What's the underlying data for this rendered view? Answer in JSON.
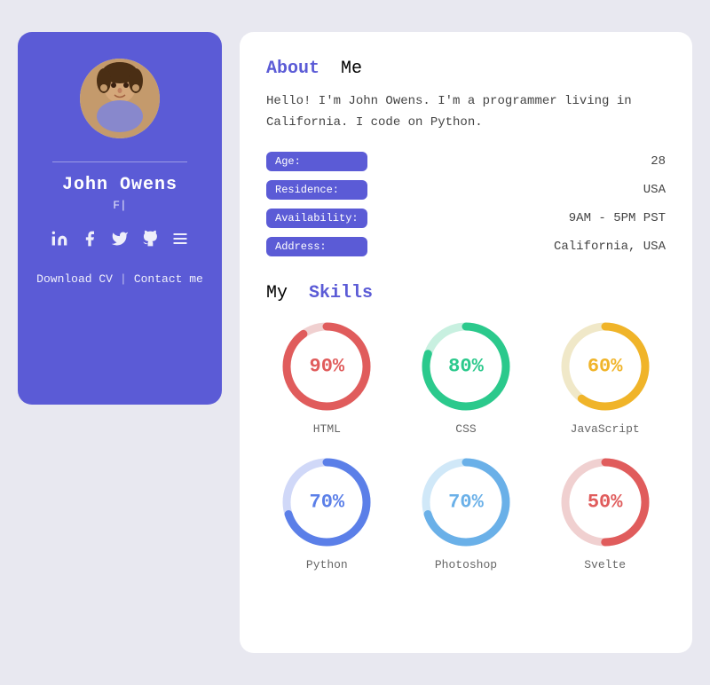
{
  "leftCard": {
    "name": "John Owens",
    "subtitle": "F|",
    "downloadLabel": "Download CV",
    "contactLabel": "Contact me",
    "separator": "|",
    "socialIcons": [
      {
        "name": "linkedin-icon",
        "symbol": "in"
      },
      {
        "name": "facebook-icon",
        "symbol": "f"
      },
      {
        "name": "twitter-icon",
        "symbol": "t"
      },
      {
        "name": "github-icon",
        "symbol": "gh"
      },
      {
        "name": "stack-icon",
        "symbol": "≡"
      }
    ]
  },
  "rightCard": {
    "aboutTitle1": "About",
    "aboutTitle2": "Me",
    "aboutText": "Hello! I'm John Owens. I'm a programmer living in California. I code on Python.",
    "infoItems": [
      {
        "label": "Age:",
        "value": "28"
      },
      {
        "label": "Residence:",
        "value": "USA"
      },
      {
        "label": "Availability:",
        "value": "9AM - 5PM PST"
      },
      {
        "label": "Address:",
        "value": "California, USA"
      }
    ],
    "skillsTitle1": "My",
    "skillsTitle2": "Skills",
    "skills": [
      {
        "name": "HTML",
        "percent": 90,
        "color": "#e05c5c",
        "bg": "#f0d0d0"
      },
      {
        "name": "CSS",
        "percent": 80,
        "color": "#2bc98c",
        "bg": "#c8f0e0"
      },
      {
        "name": "JavaScript",
        "percent": 60,
        "color": "#f0b429",
        "bg": "#f0e8c8"
      },
      {
        "name": "Python",
        "percent": 70,
        "color": "#5b7fe8",
        "bg": "#d0d8f8"
      },
      {
        "name": "Photoshop",
        "percent": 70,
        "color": "#6ab0e8",
        "bg": "#d0e8f8"
      },
      {
        "name": "Svelte",
        "percent": 50,
        "color": "#e05c5c",
        "bg": "#f0d0d0"
      }
    ]
  },
  "colors": {
    "accent": "#5b5bd6",
    "cardBg": "#fff",
    "leftBg": "#5b5bd6"
  }
}
